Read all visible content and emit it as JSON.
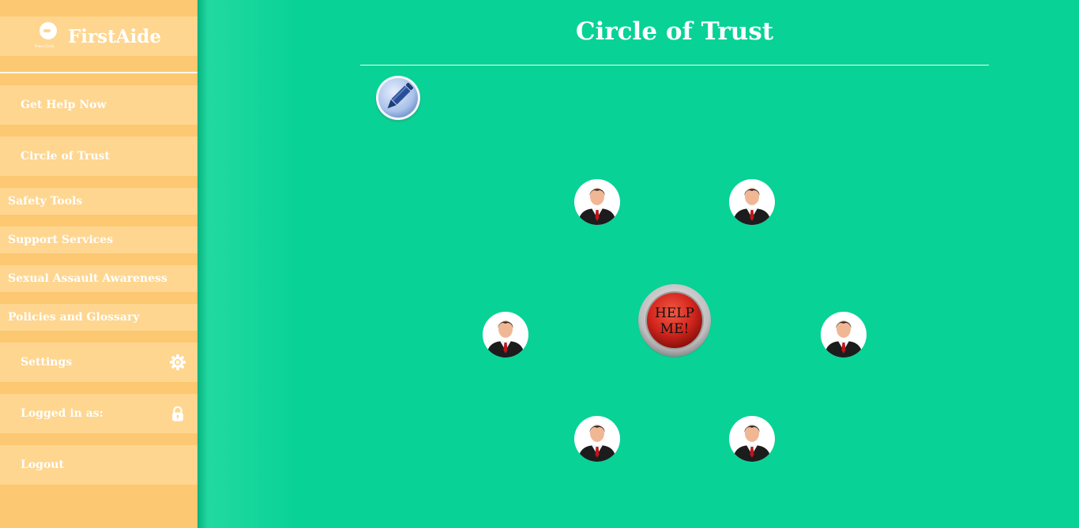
{
  "app": {
    "name": "FirstAide",
    "logo_subtext": "Peace Circle"
  },
  "page": {
    "title": "Circle of Trust"
  },
  "sidebar": {
    "items": [
      {
        "label": "Get Help Now"
      },
      {
        "label": "Circle of Trust"
      },
      {
        "label": "Safety Tools"
      },
      {
        "label": "Support Services"
      },
      {
        "label": "Sexual Assault Awareness"
      },
      {
        "label": "Policies and Glossary"
      },
      {
        "label": "Settings",
        "icon": "gear-icon"
      },
      {
        "label": "Logged in as:",
        "icon": "lock-icon"
      },
      {
        "label": "Logout"
      }
    ]
  },
  "main": {
    "edit_icon": "pencil-icon",
    "contact_icon": "person-icon",
    "help_button": {
      "line1": "HELP",
      "line2": "ME!"
    }
  },
  "colors": {
    "background": "#08d296",
    "sidebar": "#fcc871",
    "sidebar_item": "#fed690",
    "help_red": "#d3261e"
  }
}
